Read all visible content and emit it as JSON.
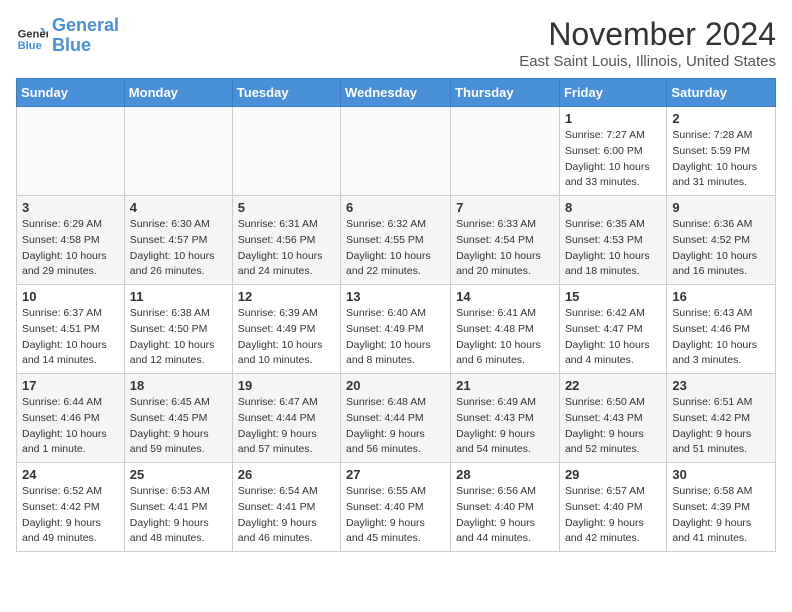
{
  "logo": {
    "line1": "General",
    "line2": "Blue"
  },
  "title": "November 2024",
  "subtitle": "East Saint Louis, Illinois, United States",
  "weekdays": [
    "Sunday",
    "Monday",
    "Tuesday",
    "Wednesday",
    "Thursday",
    "Friday",
    "Saturday"
  ],
  "weeks": [
    [
      {
        "day": "",
        "info": ""
      },
      {
        "day": "",
        "info": ""
      },
      {
        "day": "",
        "info": ""
      },
      {
        "day": "",
        "info": ""
      },
      {
        "day": "",
        "info": ""
      },
      {
        "day": "1",
        "info": "Sunrise: 7:27 AM\nSunset: 6:00 PM\nDaylight: 10 hours and 33 minutes."
      },
      {
        "day": "2",
        "info": "Sunrise: 7:28 AM\nSunset: 5:59 PM\nDaylight: 10 hours and 31 minutes."
      }
    ],
    [
      {
        "day": "3",
        "info": "Sunrise: 6:29 AM\nSunset: 4:58 PM\nDaylight: 10 hours and 29 minutes."
      },
      {
        "day": "4",
        "info": "Sunrise: 6:30 AM\nSunset: 4:57 PM\nDaylight: 10 hours and 26 minutes."
      },
      {
        "day": "5",
        "info": "Sunrise: 6:31 AM\nSunset: 4:56 PM\nDaylight: 10 hours and 24 minutes."
      },
      {
        "day": "6",
        "info": "Sunrise: 6:32 AM\nSunset: 4:55 PM\nDaylight: 10 hours and 22 minutes."
      },
      {
        "day": "7",
        "info": "Sunrise: 6:33 AM\nSunset: 4:54 PM\nDaylight: 10 hours and 20 minutes."
      },
      {
        "day": "8",
        "info": "Sunrise: 6:35 AM\nSunset: 4:53 PM\nDaylight: 10 hours and 18 minutes."
      },
      {
        "day": "9",
        "info": "Sunrise: 6:36 AM\nSunset: 4:52 PM\nDaylight: 10 hours and 16 minutes."
      }
    ],
    [
      {
        "day": "10",
        "info": "Sunrise: 6:37 AM\nSunset: 4:51 PM\nDaylight: 10 hours and 14 minutes."
      },
      {
        "day": "11",
        "info": "Sunrise: 6:38 AM\nSunset: 4:50 PM\nDaylight: 10 hours and 12 minutes."
      },
      {
        "day": "12",
        "info": "Sunrise: 6:39 AM\nSunset: 4:49 PM\nDaylight: 10 hours and 10 minutes."
      },
      {
        "day": "13",
        "info": "Sunrise: 6:40 AM\nSunset: 4:49 PM\nDaylight: 10 hours and 8 minutes."
      },
      {
        "day": "14",
        "info": "Sunrise: 6:41 AM\nSunset: 4:48 PM\nDaylight: 10 hours and 6 minutes."
      },
      {
        "day": "15",
        "info": "Sunrise: 6:42 AM\nSunset: 4:47 PM\nDaylight: 10 hours and 4 minutes."
      },
      {
        "day": "16",
        "info": "Sunrise: 6:43 AM\nSunset: 4:46 PM\nDaylight: 10 hours and 3 minutes."
      }
    ],
    [
      {
        "day": "17",
        "info": "Sunrise: 6:44 AM\nSunset: 4:46 PM\nDaylight: 10 hours and 1 minute."
      },
      {
        "day": "18",
        "info": "Sunrise: 6:45 AM\nSunset: 4:45 PM\nDaylight: 9 hours and 59 minutes."
      },
      {
        "day": "19",
        "info": "Sunrise: 6:47 AM\nSunset: 4:44 PM\nDaylight: 9 hours and 57 minutes."
      },
      {
        "day": "20",
        "info": "Sunrise: 6:48 AM\nSunset: 4:44 PM\nDaylight: 9 hours and 56 minutes."
      },
      {
        "day": "21",
        "info": "Sunrise: 6:49 AM\nSunset: 4:43 PM\nDaylight: 9 hours and 54 minutes."
      },
      {
        "day": "22",
        "info": "Sunrise: 6:50 AM\nSunset: 4:43 PM\nDaylight: 9 hours and 52 minutes."
      },
      {
        "day": "23",
        "info": "Sunrise: 6:51 AM\nSunset: 4:42 PM\nDaylight: 9 hours and 51 minutes."
      }
    ],
    [
      {
        "day": "24",
        "info": "Sunrise: 6:52 AM\nSunset: 4:42 PM\nDaylight: 9 hours and 49 minutes."
      },
      {
        "day": "25",
        "info": "Sunrise: 6:53 AM\nSunset: 4:41 PM\nDaylight: 9 hours and 48 minutes."
      },
      {
        "day": "26",
        "info": "Sunrise: 6:54 AM\nSunset: 4:41 PM\nDaylight: 9 hours and 46 minutes."
      },
      {
        "day": "27",
        "info": "Sunrise: 6:55 AM\nSunset: 4:40 PM\nDaylight: 9 hours and 45 minutes."
      },
      {
        "day": "28",
        "info": "Sunrise: 6:56 AM\nSunset: 4:40 PM\nDaylight: 9 hours and 44 minutes."
      },
      {
        "day": "29",
        "info": "Sunrise: 6:57 AM\nSunset: 4:40 PM\nDaylight: 9 hours and 42 minutes."
      },
      {
        "day": "30",
        "info": "Sunrise: 6:58 AM\nSunset: 4:39 PM\nDaylight: 9 hours and 41 minutes."
      }
    ]
  ]
}
